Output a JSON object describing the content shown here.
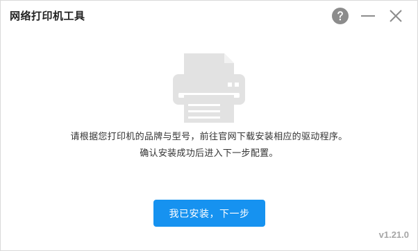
{
  "window": {
    "title": "网络打印机工具"
  },
  "controls": {
    "help_icon": "question-circle-icon",
    "minimize_icon": "minimize-icon",
    "close_icon": "close-icon"
  },
  "illustration": {
    "icon": "printer-icon"
  },
  "message": {
    "line1": "请根据您打印机的品牌与型号，前往官网下载安装相应的驱动程序。",
    "line2": "确认安装成功后进入下一步配置。"
  },
  "actions": {
    "next_label": "我已安装，下一步"
  },
  "footer": {
    "version": "v1.21.0"
  },
  "colors": {
    "primary": "#1692f0",
    "icon_gray": "#e2e2e2",
    "control_gray": "#8c8c8c",
    "version_gray": "#a6a6a6"
  }
}
